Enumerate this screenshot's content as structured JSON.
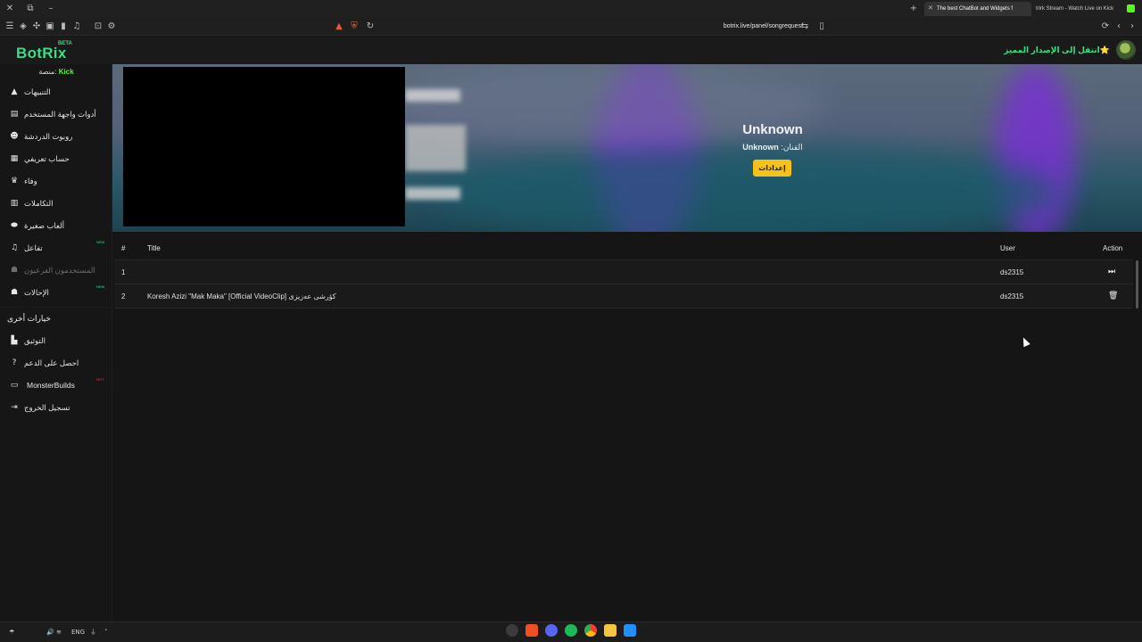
{
  "browser": {
    "tabs": [
      {
        "label": "The best ChatBot and Widgets f"
      },
      {
        "label": "trirk Stream - Watch Live on Kick"
      }
    ],
    "url": "botrix.live/panel/songrequest"
  },
  "header": {
    "logo": "BotRix",
    "logo_badge": "BETA",
    "premium_link": "انتقل إلى الإصدار المميز⭐"
  },
  "sidebar": {
    "platform_label": "منصة:",
    "platform_value": "Kick",
    "items": [
      {
        "label": "التنبيهات",
        "icon": "warning-icon"
      },
      {
        "label": "أدوات واجهة المستخدم",
        "icon": "widgets-icon"
      },
      {
        "label": "روبوت الدردشة",
        "icon": "robot-icon"
      },
      {
        "label": "حساب تعريفي",
        "icon": "profile-icon"
      },
      {
        "label": "وفاء",
        "icon": "trophy-icon"
      },
      {
        "label": "التكاملات",
        "icon": "integrations-icon"
      },
      {
        "label": "ألعاب صغيرة",
        "icon": "gamepad-icon"
      },
      {
        "label": "تفاعل",
        "icon": "music-icon",
        "badge": "NEW"
      },
      {
        "label": "المستخدمون الفرعيون",
        "icon": "users-icon"
      },
      {
        "label": "الإحالات",
        "icon": "referrals-icon",
        "badge": "NEW"
      }
    ],
    "more_header": "خيارات أخرى",
    "more_items": [
      {
        "label": "التوثيق",
        "icon": "book-icon"
      },
      {
        "label": "احصل على الدعم",
        "icon": "help-icon"
      },
      {
        "label": "MonsterBuilds",
        "icon": "laptop-icon",
        "badge": "HOT"
      },
      {
        "label": "تسجيل الخروج",
        "icon": "logout-icon"
      }
    ]
  },
  "player": {
    "song_title": "Unknown",
    "artist_label": "الفنان:",
    "artist_value": "Unknown",
    "settings_label": "إعدادات"
  },
  "queue": {
    "headers": {
      "num": "#",
      "title": "Title",
      "user": "User",
      "action": "Action"
    },
    "rows": [
      {
        "num": "1",
        "title": "",
        "user": "ds2315",
        "action": "skip-icon"
      },
      {
        "num": "2",
        "title": "Koresh Azizi \"Mak Maka\" [Official VideoClip] کۆرشی عەزیزی",
        "user": "ds2315",
        "action": "trash-icon"
      }
    ]
  },
  "taskbar": {
    "lang": "ENG"
  }
}
